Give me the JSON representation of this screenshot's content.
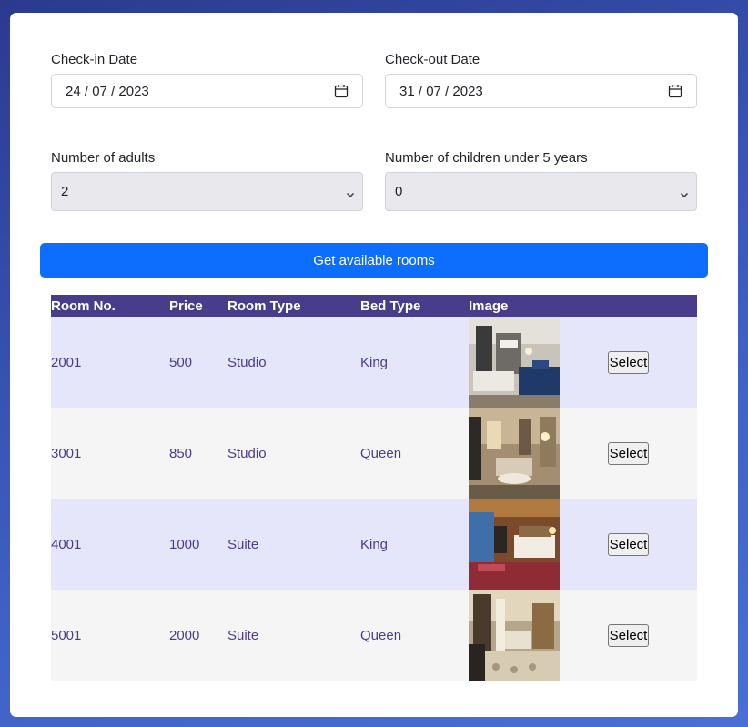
{
  "form": {
    "checkin": {
      "label": "Check-in Date",
      "day": "24",
      "month": "07",
      "year": "2023"
    },
    "checkout": {
      "label": "Check-out Date",
      "day": "31",
      "month": "07",
      "year": "2023"
    },
    "adults": {
      "label": "Number of adults",
      "value": "2"
    },
    "children": {
      "label": "Number of children under 5 years",
      "value": "0"
    },
    "submit_label": "Get available rooms"
  },
  "table": {
    "headers": [
      "Room No.",
      "Price",
      "Room Type",
      "Bed Type",
      "Image",
      ""
    ],
    "rows": [
      {
        "room_no": "2001",
        "price": "500",
        "room_type": "Studio",
        "bed_type": "King",
        "action": "Select"
      },
      {
        "room_no": "3001",
        "price": "850",
        "room_type": "Studio",
        "bed_type": "Queen",
        "action": "Select"
      },
      {
        "room_no": "4001",
        "price": "1000",
        "room_type": "Suite",
        "bed_type": "King",
        "action": "Select"
      },
      {
        "room_no": "5001",
        "price": "2000",
        "room_type": "Suite",
        "bed_type": "Queen",
        "action": "Select"
      }
    ]
  },
  "colors": {
    "primary": "#0d6efd",
    "header_bg": "#483d8b",
    "row_odd": "#e6e6fa",
    "row_even": "#f5f5f5",
    "text_accent": "#483d8b"
  },
  "icons": {
    "date": "calendar-icon",
    "select": "chevron-down-icon"
  }
}
